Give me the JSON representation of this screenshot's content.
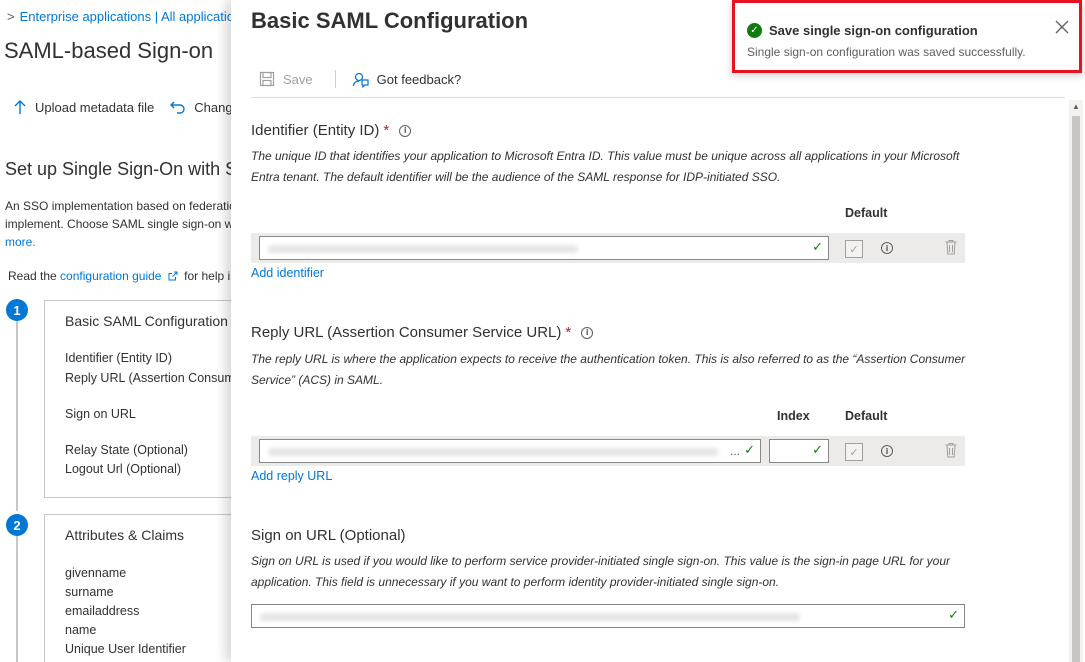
{
  "breadcrumb": {
    "chevron": ">",
    "text": "Enterprise applications | All applications"
  },
  "background": {
    "title": "SAML-based Sign-on",
    "toolbar": {
      "upload_label": "Upload metadata file",
      "change_label": "Change single sign-on mode"
    },
    "heading": "Set up Single Sign-On with SAML",
    "intro_lines": [
      "An SSO implementation based on federation protocols improves security, reliability, and end user experiences and is easier to",
      "implement. Choose SAML single sign-on whenever possible for existing applications that do not use OpenID Connect or OAuth. Learn"
    ],
    "intro_more": "more.",
    "guide_prefix": "Read the ",
    "guide_link": "configuration guide",
    "guide_suffix": " for help integrating",
    "steps": [
      {
        "number": "1",
        "title": "Basic SAML Configuration",
        "items": [
          "Identifier (Entity ID)",
          "Reply URL (Assertion Consumer Service URL)",
          "Sign on URL",
          "Relay State (Optional)",
          "Logout Url (Optional)"
        ]
      },
      {
        "number": "2",
        "title": "Attributes & Claims",
        "items": [
          "givenname",
          "surname",
          "emailaddress",
          "name",
          "Unique User Identifier"
        ]
      }
    ]
  },
  "blade": {
    "title": "Basic SAML Configuration",
    "toolbar": {
      "save_label": "Save",
      "feedback_label": "Got feedback?"
    },
    "identifier": {
      "label": "Identifier (Entity ID)",
      "required_marker": "*",
      "description": "The unique ID that identifies your application to Microsoft Entra ID. This value must be unique across all applications in your Microsoft Entra tenant. The default identifier will be the audience of the SAML response for IDP-initiated SSO.",
      "default_header": "Default",
      "add_link": "Add identifier"
    },
    "reply_url": {
      "label": "Reply URL (Assertion Consumer Service URL)",
      "required_marker": "*",
      "description": "The reply URL is where the application expects to receive the authentication token. This is also referred to as the “Assertion Consumer Service” (ACS) in SAML.",
      "index_header": "Index",
      "default_header": "Default",
      "ellipsis": "...",
      "add_link": "Add reply URL"
    },
    "sign_on_url": {
      "label": "Sign on URL (Optional)",
      "description": "Sign on URL is used if you would like to perform service provider-initiated single sign-on. This value is the sign-in page URL for your application. This field is unnecessary if you want to perform identity provider-initiated single sign-on."
    }
  },
  "toast": {
    "title": "Save single sign-on configuration",
    "message": "Single sign-on configuration was saved successfully.",
    "border_color": "#e81123",
    "status_color": "#107c10"
  },
  "colors": {
    "accent": "#0078d4",
    "required": "#a4262c",
    "success": "#107c10"
  }
}
